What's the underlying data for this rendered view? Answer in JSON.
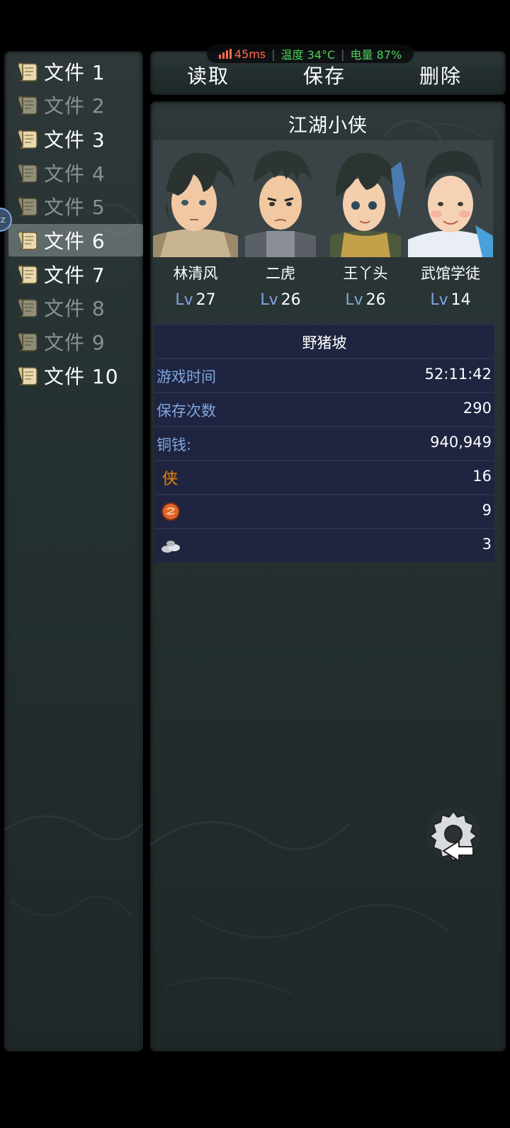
{
  "status": {
    "ping": "45ms",
    "temperature": "温度 34°C",
    "battery": "电量 87%"
  },
  "files": [
    {
      "label": "文件 1",
      "state": "saved"
    },
    {
      "label": "文件 2",
      "state": "empty"
    },
    {
      "label": "文件 3",
      "state": "saved"
    },
    {
      "label": "文件 4",
      "state": "empty"
    },
    {
      "label": "文件 5",
      "state": "empty"
    },
    {
      "label": "文件 6",
      "state": "selected"
    },
    {
      "label": "文件 7",
      "state": "saved"
    },
    {
      "label": "文件 8",
      "state": "empty"
    },
    {
      "label": "文件 9",
      "state": "empty"
    },
    {
      "label": "文件 10",
      "state": "saved"
    }
  ],
  "toolbar": {
    "load": "读取",
    "save": "保存",
    "delete": "删除"
  },
  "save": {
    "title": "江湖小侠",
    "party": [
      {
        "name": "林清风",
        "lv_label": "Lv",
        "level": "27"
      },
      {
        "name": "二虎",
        "lv_label": "Lv",
        "level": "26"
      },
      {
        "name": "王丫头",
        "lv_label": "Lv",
        "level": "26"
      },
      {
        "name": "武馆学徒",
        "lv_label": "Lv",
        "level": "14"
      }
    ],
    "location": "野猪坡",
    "stats": [
      {
        "key": "游戏时间",
        "value": "52:11:42"
      },
      {
        "key": "保存次数",
        "value": "290"
      },
      {
        "key": "铜钱:",
        "value": "940,949"
      }
    ],
    "items": [
      {
        "icon": "xia-token-icon",
        "value": "16"
      },
      {
        "icon": "copper-coin-icon",
        "value": "9"
      },
      {
        "icon": "silver-ingot-icon",
        "value": "3"
      }
    ]
  }
}
